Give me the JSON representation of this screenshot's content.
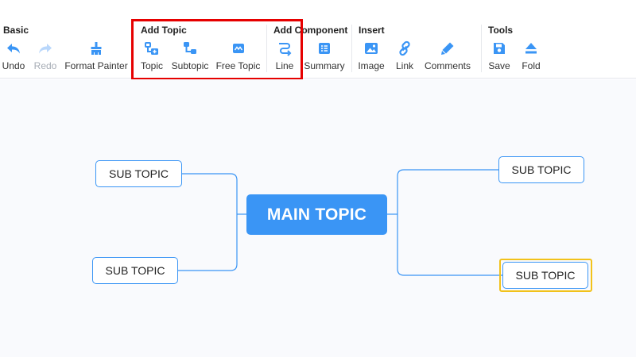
{
  "toolbar": {
    "groups": {
      "basic": "Basic",
      "add_topic": "Add Topic",
      "add_component": "Add Component",
      "insert": "Insert",
      "tools": "Tools"
    },
    "tools": {
      "undo": "Undo",
      "redo": "Redo",
      "format_painter": "Format Painter",
      "topic": "Topic",
      "subtopic": "Subtopic",
      "free_topic": "Free Topic",
      "line": "Line",
      "summary": "Summary",
      "image": "Image",
      "link": "Link",
      "comments": "Comments",
      "save": "Save",
      "fold": "Fold"
    },
    "icons": {
      "undo": "undo-icon",
      "redo": "redo-icon",
      "format_painter": "brush-icon",
      "topic": "topic-icon",
      "subtopic": "subtopic-icon",
      "free_topic": "free-topic-icon",
      "line": "line-icon",
      "summary": "summary-icon",
      "image": "image-icon",
      "link": "link-icon",
      "comments": "pen-icon",
      "save": "save-icon",
      "fold": "fold-icon"
    },
    "redo_disabled": true
  },
  "mindmap": {
    "main_topic": "MAIN TOPIC",
    "left_subtopics": [
      "SUB TOPIC",
      "SUB TOPIC"
    ],
    "right_subtopics": [
      "SUB TOPIC",
      "SUB TOPIC"
    ],
    "selected_subtopic": "right-2"
  },
  "colors": {
    "accent": "#3a95f5",
    "highlight_box": "#e60000",
    "selection": "#f2c21b",
    "canvas_bg": "#f9fafd",
    "disabled": "#b9d7fb"
  }
}
